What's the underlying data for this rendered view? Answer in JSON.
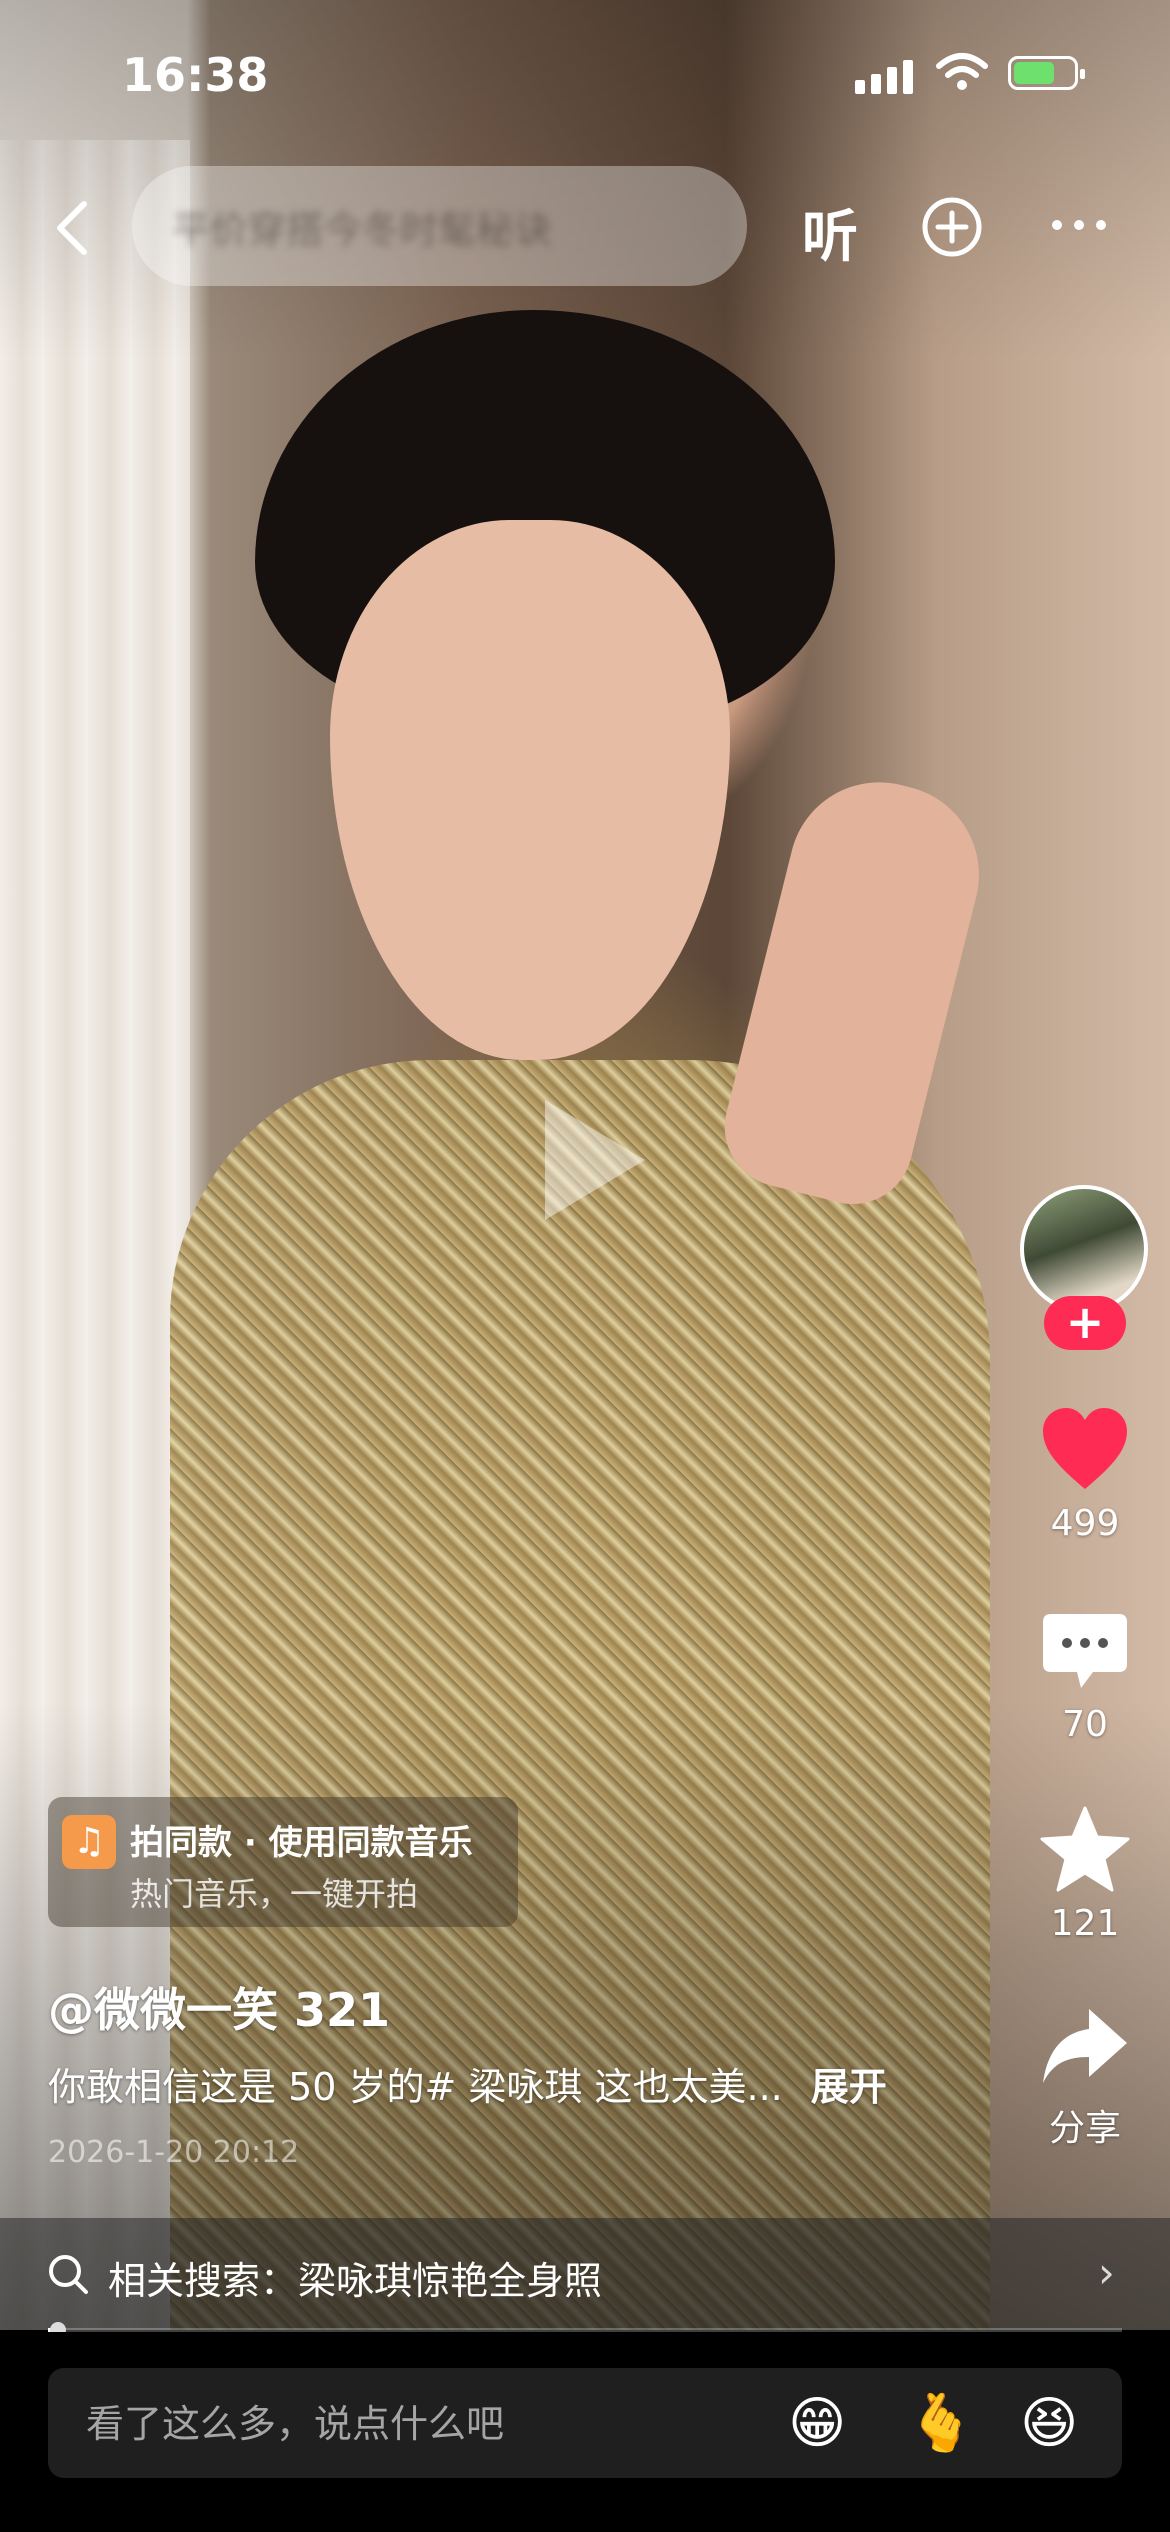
{
  "status_bar": {
    "time": "16:38"
  },
  "nav": {
    "search_placeholder": "平价穿搭今冬时髦秘诀",
    "listen_label": "听"
  },
  "video": {
    "state": "paused"
  },
  "right_rail": {
    "likes": "499",
    "comments": "70",
    "favorites": "121",
    "share_label": "分享",
    "follow_symbol": "+"
  },
  "music_card": {
    "icon": "♫",
    "title": "拍同款 · 使用同款音乐",
    "subtitle": "热门音乐，一键开拍"
  },
  "post": {
    "author": "@微微一笑 321",
    "caption": "你敢相信这是 50 岁的# 梁咏琪 这也太美...",
    "expand_label": "展开",
    "date": "2026-1-20 20:12"
  },
  "related_search": {
    "label": "相关搜索：梁咏琪惊艳全身照",
    "chevron": "›"
  },
  "progress": {
    "fraction": 0.01
  },
  "comment_input": {
    "placeholder": "看了这么多，说点什么吧",
    "emojis": [
      "😁",
      "🫰",
      "😆"
    ]
  },
  "colors": {
    "like_red": "#fe2c55",
    "music_orange": "#f59a4a"
  }
}
